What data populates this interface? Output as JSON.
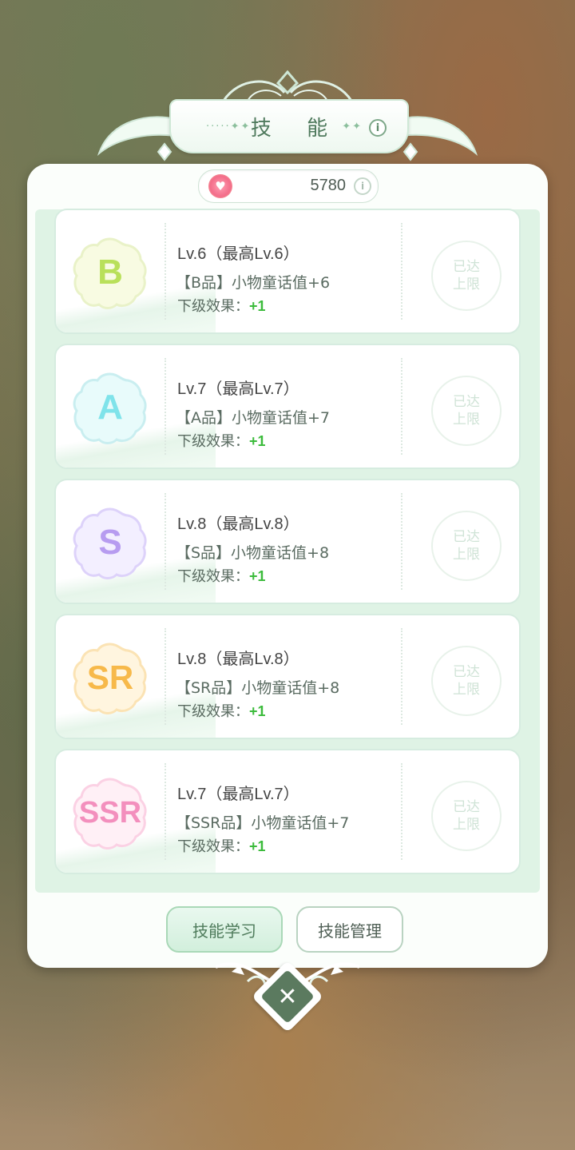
{
  "title": "技 能",
  "title_deco_left": "·····✦✦",
  "title_deco_right": "✦✦",
  "info_symbol": "i",
  "currency": {
    "icon": "heart-shell-icon",
    "value": "5780"
  },
  "skills": [
    {
      "grade": "B",
      "grade_color": "#b9e05a",
      "bg_color": "#f8fbe2",
      "level": "Lv.6（最高Lv.6）",
      "effect": "【B品】小物童话值+6",
      "next_label": "下级效果：",
      "next_value": "+1",
      "status": "已达上限"
    },
    {
      "grade": "A",
      "grade_color": "#7fe3ea",
      "bg_color": "#e8fbfb",
      "level": "Lv.7（最高Lv.7）",
      "effect": "【A品】小物童话值+7",
      "next_label": "下级效果：",
      "next_value": "+1",
      "status": "已达上限"
    },
    {
      "grade": "S",
      "grade_color": "#b79cf0",
      "bg_color": "#f3efff",
      "level": "Lv.8（最高Lv.8）",
      "effect": "【S品】小物童话值+8",
      "next_label": "下级效果：",
      "next_value": "+1",
      "status": "已达上限"
    },
    {
      "grade": "SR",
      "grade_color": "#f7b94a",
      "bg_color": "#fff5df",
      "level": "Lv.8（最高Lv.8）",
      "effect": "【SR品】小物童话值+8",
      "next_label": "下级效果：",
      "next_value": "+1",
      "status": "已达上限"
    },
    {
      "grade": "SSR",
      "grade_color": "#f38fbd",
      "bg_color": "#fff0f6",
      "level": "Lv.7（最高Lv.7）",
      "effect": "【SSR品】小物童话值+7",
      "next_label": "下级效果：",
      "next_value": "+1",
      "status": "已达上限"
    }
  ],
  "buttons": {
    "learn": "技能学习",
    "manage": "技能管理"
  },
  "close_symbol": "✕"
}
